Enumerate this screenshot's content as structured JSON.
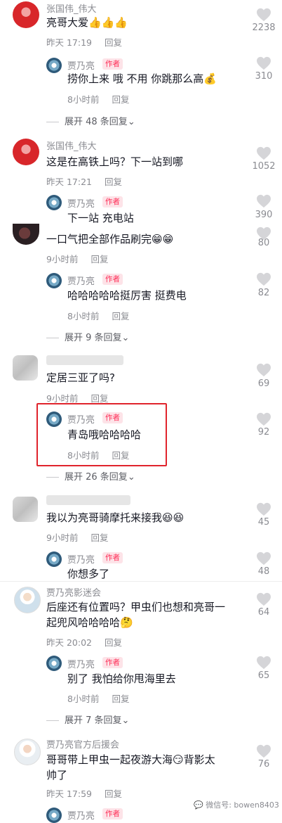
{
  "comments": [
    {
      "user": "张国伟_伟大",
      "text": "亮哥大爱",
      "emoji": "👍👍👍",
      "time": "昨天 17:19",
      "reply": "回复",
      "likes": "2238"
    },
    {
      "user": "贾乃亮",
      "tag": "作者",
      "text": "捞你上来 哦 不用 你跳那么高",
      "emoji": "💰",
      "time": "8小时前",
      "reply": "回复",
      "likes": "310"
    },
    {
      "expand": "展开 48 条回复"
    },
    {
      "user": "张国伟_伟大",
      "text": "这是在高铁上吗？下一站到哪",
      "time": "昨天 17:21",
      "reply": "回复",
      "likes": "1052"
    },
    {
      "user": "贾乃亮",
      "tag": "作者",
      "text": "下一站 充电站",
      "likes": "390"
    },
    {
      "text": "一口气把全部作品刷完",
      "emoji": "😁😁",
      "time": "9小时前",
      "reply": "回复",
      "likes": "80"
    },
    {
      "user": "贾乃亮",
      "tag": "作者",
      "text": "哈哈哈哈哈挺厉害 挺费电",
      "time": "8小时前",
      "reply": "回复",
      "likes": "82"
    },
    {
      "expand": "展开 9 条回复"
    },
    {
      "text": "定居三亚了吗?",
      "time": "9小时前",
      "reply": "回复",
      "likes": "69"
    },
    {
      "user": "贾乃亮",
      "tag": "作者",
      "text": "青岛哦哈哈哈哈",
      "time": "8小时前",
      "reply": "回复",
      "likes": "92"
    },
    {
      "expand": "展开 26 条回复"
    },
    {
      "text": "我以为亮哥骑摩托来接我",
      "emoji": "😆😆",
      "time": "9小时前",
      "reply": "回复",
      "likes": "45"
    },
    {
      "user": "贾乃亮",
      "tag": "作者",
      "text": "你想多了",
      "likes": "48"
    },
    {
      "user": "贾乃亮影迷会",
      "text": "后座还有位置吗？甲虫们也想和亮哥一",
      "text2": "起兜风哈哈哈哈",
      "emoji": "🤔",
      "time": "昨天 20:02",
      "reply": "回复",
      "likes": "64"
    },
    {
      "user": "贾乃亮",
      "tag": "作者",
      "text": "别了 我怕给你甩海里去",
      "time": "8小时前",
      "reply": "回复",
      "likes": "65"
    },
    {
      "expand": "展开 7 条回复"
    },
    {
      "user": "贾乃亮官方后援会",
      "text": "哥哥带上甲虫一起夜游大海",
      "emoji": "😏",
      "text_tail": "背影太",
      "text2": "帅了",
      "time": "昨天 17:59",
      "reply": "回复",
      "likes": "76"
    },
    {
      "user": "贾乃亮",
      "tag": "作者"
    }
  ],
  "watermark": "微信号: bowen8403",
  "colors": {
    "accent": "#fe2c55",
    "highlight": "#e0242c"
  },
  "icons": {
    "like": "heart-outline-icon",
    "expand": "chevron-down-icon"
  }
}
